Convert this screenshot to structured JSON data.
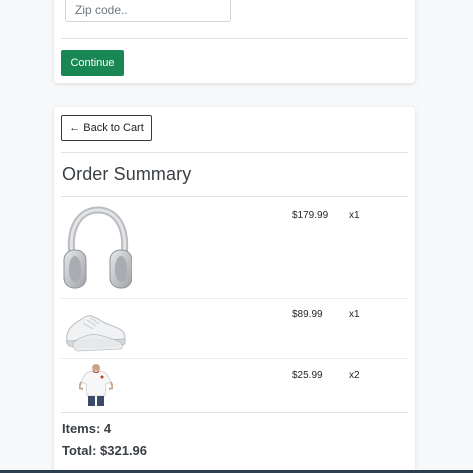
{
  "shipping_form": {
    "zip_placeholder": "Zip code..",
    "zip_value": "",
    "continue_label": "Continue"
  },
  "summary": {
    "back_label": "← Back to Cart",
    "title": "Order Summary",
    "items": [
      {
        "name": "headphones",
        "icon": "headphones-icon",
        "price": "$179.99",
        "qty": "x1"
      },
      {
        "name": "sneakers",
        "icon": "sneaker-icon",
        "price": "$89.99",
        "qty": "x1"
      },
      {
        "name": "t-shirt",
        "icon": "tshirt-icon",
        "price": "$25.99",
        "qty": "x2"
      }
    ],
    "items_count": "Items: 4",
    "total": "Total: $321.96"
  },
  "colors": {
    "continue_button": "#198754",
    "background": "#f8f9fa",
    "bottom_bar": "#2c3e50"
  }
}
